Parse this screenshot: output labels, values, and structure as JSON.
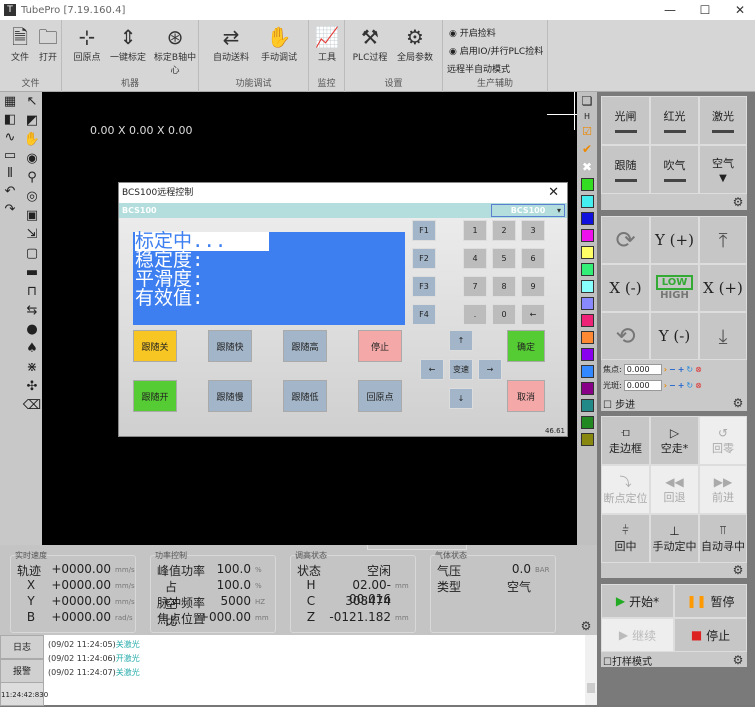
{
  "window": {
    "logo": "T",
    "title": "TubePro  [7.19.160.4]",
    "min": "—",
    "max": "☐",
    "close": "✕"
  },
  "ribbon": {
    "groups": [
      {
        "label": "文件",
        "buttons": [
          {
            "label": "文件",
            "icon": "file-icon"
          },
          {
            "label": "打开",
            "icon": "folder-icon"
          }
        ]
      },
      {
        "label": "机器",
        "buttons": [
          {
            "label": "回原点",
            "icon": "origin-axes-icon"
          },
          {
            "label": "一键标定",
            "icon": "calibrate-icon"
          },
          {
            "label": "标定B轴中心",
            "icon": "b-axis-center-icon"
          }
        ]
      },
      {
        "label": "功能调试",
        "buttons": [
          {
            "label": "自动送料",
            "icon": "auto-feed-icon"
          },
          {
            "label": "手动调试",
            "icon": "manual-debug-icon"
          }
        ]
      },
      {
        "label": "监控",
        "buttons": [
          {
            "label": "工具",
            "icon": "monitor-icon"
          }
        ]
      },
      {
        "label": "设置",
        "buttons": [
          {
            "label": "PLC过程",
            "icon": "plc-icon"
          },
          {
            "label": "全局参数",
            "icon": "gear-icon"
          }
        ]
      },
      {
        "label": "生产辅助",
        "options": [
          "开启捡料",
          "启用IO/并行PLC捡料"
        ],
        "link": "远程半自动模式"
      }
    ]
  },
  "canvas": {
    "coords": "0.00 X 0.00 X 0.00"
  },
  "color_strip": {
    "colors": [
      "#33dd22",
      "#44eeee",
      "#1111dd",
      "#ee11ee",
      "#ffff66",
      "#33ee77",
      "#88ffff",
      "#8888ff",
      "#ee2277",
      "#ff8833",
      "#8800ee",
      "#3388ff",
      "#880088",
      "#228888",
      "#228822",
      "#888811"
    ]
  },
  "right_panel": {
    "toggles": [
      "光闸",
      "红光",
      "激光",
      "跟随",
      "吹气",
      "空气"
    ],
    "jog": {
      "y_plus": "Y (+)",
      "y_minus": "Y (-)",
      "x_minus": "X (-)",
      "x_plus": "X (+)",
      "low": "LOW",
      "high": "HIGH"
    },
    "focus_label": "焦点:",
    "focus_value": "0.000",
    "spot_label": "光斑:",
    "spot_value": "0.000",
    "step_label": "步进",
    "motion": [
      "走边框",
      "空走*",
      "回零",
      "断点定位",
      "回退",
      "前进",
      "回中",
      "手动定中",
      "自动寻中"
    ],
    "run": {
      "start": "开始*",
      "pause": "暂停",
      "resume": "继续",
      "stop": "停止",
      "sample_mode": "打样模式"
    }
  },
  "dialog": {
    "title": "BCS100远程控制",
    "close": "✕",
    "device": "BCS100",
    "device_select": "BCS100",
    "lcd": [
      "标定中...",
      "稳定度:",
      "平滑度:",
      "有效值:"
    ],
    "buttons": [
      "跟随关",
      "跟随快",
      "跟随高",
      "停止",
      "跟随开",
      "跟随慢",
      "跟随低",
      "回原点"
    ],
    "fkeys": [
      "F1",
      "F2",
      "F3",
      "F4"
    ],
    "keypad": [
      "1",
      "2",
      "3",
      "4",
      "5",
      "6",
      "7",
      "8",
      "9",
      ".",
      "0",
      "←"
    ],
    "arrows": {
      "up": "↑",
      "down": "↓",
      "left": "←",
      "right": "→",
      "speed": "变速"
    },
    "ok": "确定",
    "cancel": "取消",
    "footer": "46.61"
  },
  "status": {
    "speed": {
      "title": "实时速度",
      "rows": [
        [
          "轨迹",
          "+0000.00",
          "mm/s"
        ],
        [
          "X",
          "+0000.00",
          "mm/s"
        ],
        [
          "Y",
          "+0000.00",
          "mm/s"
        ],
        [
          "B",
          "+0000.00",
          "rad/s"
        ]
      ]
    },
    "power": {
      "title": "功率控制",
      "rows": [
        [
          "峰值功率",
          "100.0",
          "%"
        ],
        [
          "占空比",
          "100.0",
          "%"
        ],
        [
          "脉冲频率",
          "5000",
          "HZ"
        ],
        [
          "焦点位置",
          "+000.00",
          "mm"
        ]
      ]
    },
    "height": {
      "title": "调高状态",
      "rows": [
        [
          "状态",
          "空闲",
          ""
        ],
        [
          "H",
          "02.00-00.016",
          "mm"
        ],
        [
          "C",
          "308474",
          ""
        ],
        [
          "Z",
          "-0121.182",
          "mm"
        ]
      ]
    },
    "gas": {
      "title": "气体状态",
      "rows": [
        [
          "气压",
          "0.0",
          "BAR"
        ],
        [
          "类型",
          "空气",
          ""
        ]
      ]
    }
  },
  "log": {
    "tabs": [
      "日志",
      "报警"
    ],
    "time": "11:24:42:830",
    "lines": [
      {
        "time": "(09/02 11:24:05)",
        "msg": "关激光"
      },
      {
        "time": "(09/02 11:24:06)",
        "msg": "开激光"
      },
      {
        "time": "(09/02 11:24:07)",
        "msg": "关激光"
      }
    ]
  }
}
